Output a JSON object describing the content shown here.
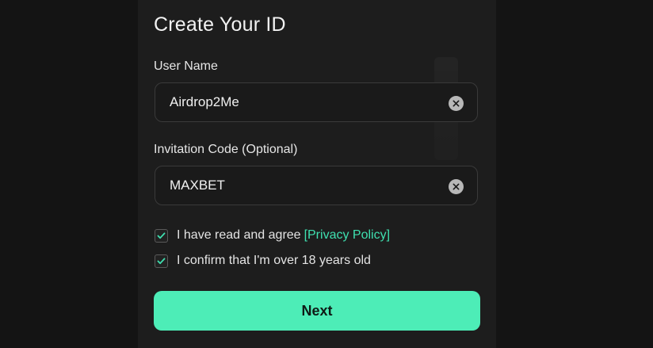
{
  "form": {
    "title": "Create Your ID",
    "username": {
      "label": "User Name",
      "value": "Airdrop2Me"
    },
    "invitation": {
      "label": "Invitation Code (Optional)",
      "value": "MAXBET"
    },
    "agreements": [
      {
        "text": "I have read and agree",
        "link": "[Privacy Policy]",
        "checked": true
      },
      {
        "text": "I confirm that I'm over 18 years old",
        "link": "",
        "checked": true
      }
    ],
    "next_label": "Next"
  },
  "colors": {
    "accent": "#4dedb7",
    "link": "#3fe0b0",
    "background": "#141414",
    "panel": "#1d1d1d"
  },
  "icons": {
    "clear": "clear-icon",
    "check": "checkmark-icon"
  }
}
